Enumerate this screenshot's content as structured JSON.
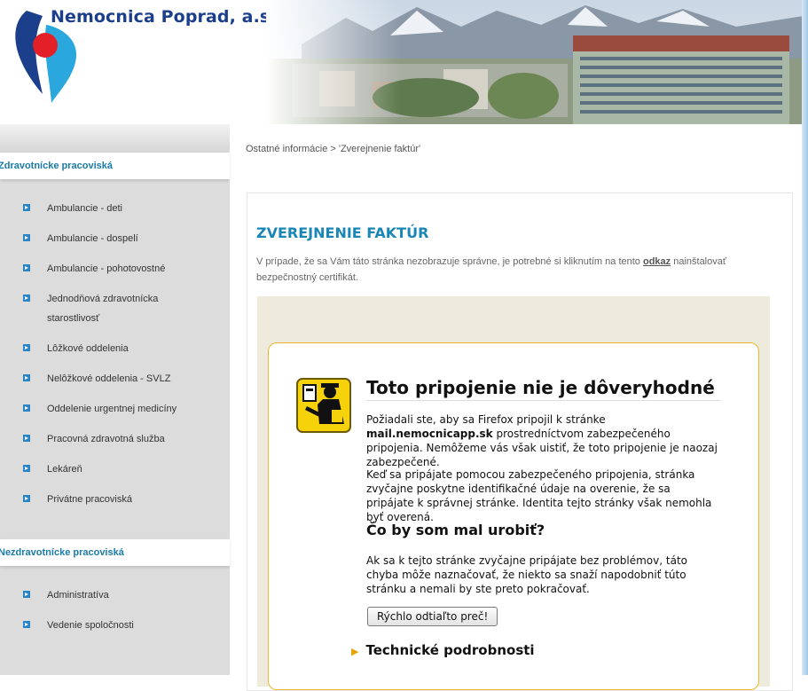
{
  "header": {
    "site_name": "Nemocnica Poprad, a.s."
  },
  "breadcrumb": "Ostatné informácie > 'Zverejnenie faktúr'",
  "sidebar": {
    "section1_title": "Zdravotnícke pracoviská",
    "section1_items": [
      {
        "label": "Ambulancie - deti"
      },
      {
        "label": "Ambulancie - dospelí"
      },
      {
        "label": "Ambulancie - pohotovostné"
      },
      {
        "label": "Jednodňová zdravotnícka"
      },
      {
        "label": "starostlivosť"
      },
      {
        "label": "Lôžkové oddelenia"
      },
      {
        "label": "Nelôžkové oddelenia - SVLZ"
      },
      {
        "label": "Oddelenie urgentnej medicíny"
      },
      {
        "label": "Pracovná zdravotná služba"
      },
      {
        "label": "Lekáreň"
      },
      {
        "label": "Privátne pracoviská"
      }
    ],
    "section2_title": "Nezdravotnícke pracoviská",
    "section2_items": [
      {
        "label": "Administratíva"
      },
      {
        "label": "Vedenie spoločnosti"
      }
    ]
  },
  "main": {
    "title": "ZVEREJNENIE FAKTÚR",
    "intro_before": "V prípade, že sa Vám táto stránka nezobrazuje správne, je potrebné si kliknutím na tento ",
    "intro_link": "odkaz",
    "intro_after": " nainštalovať bezpečnostný certifikát."
  },
  "error": {
    "title": "Toto pripojenie nie je dôveryhodné",
    "p1_before": "Požiadali ste, aby sa Firefox pripojil k stránke ",
    "p1_host": "mail.nemocnicapp.sk",
    "p1_after": " prostredníctvom zabezpečeného pripojenia. Nemôžeme vás však uistiť, že toto pripojenie je naozaj zabezpečené.",
    "p2": "Keď sa pripájate pomocou zabezpečeného pripojenia, stránka zvyčajne poskytne identifikačné údaje na overenie, že sa pripájate k správnej stránke. Identita tejto stránky však nemohla byť overená.",
    "subtitle": "Čo by som mal urobiť?",
    "p3": "Ak sa k tejto stránke zvyčajne pripájate bez problémov, táto chyba môže naznačovať, že niekto sa snaží napodobniť túto stránku a nemali by ste preto pokračovať.",
    "button_label": "Rýchlo odtiaľto preč!",
    "technical_label": "Technické podrobnosti"
  },
  "colors": {
    "brand_blue": "#1c3f8c",
    "accent_cyan": "#1a86b6",
    "logo_red": "#e32027",
    "warning_border": "#e8b82e"
  }
}
